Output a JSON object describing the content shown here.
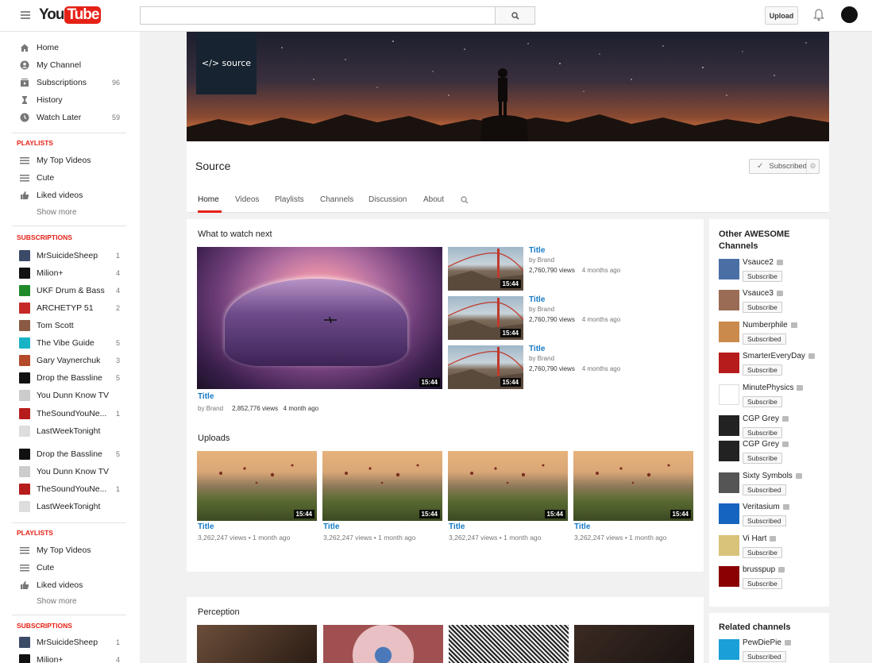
{
  "topbar": {
    "logo_you": "You",
    "logo_tube": "Tube",
    "search_placeholder": "",
    "upload_label": "Upload"
  },
  "sidebar": {
    "main": [
      {
        "label": "Home",
        "icon": "home-icon",
        "count": ""
      },
      {
        "label": "My Channel",
        "icon": "user-icon",
        "count": ""
      },
      {
        "label": "Subscriptions",
        "icon": "subscriptions-icon",
        "count": "96"
      },
      {
        "label": "History",
        "icon": "history-icon",
        "count": ""
      },
      {
        "label": "Watch Later",
        "icon": "clock-icon",
        "count": "59"
      }
    ],
    "playlists_heading": "PLAYLISTS",
    "playlists": [
      {
        "label": "My Top Videos",
        "icon": "list-icon"
      },
      {
        "label": "Cute",
        "icon": "list-icon"
      },
      {
        "label": "Liked videos",
        "icon": "thumbs-up-icon"
      }
    ],
    "show_more": "Show more",
    "subscriptions_heading": "SUBSCRIPTIONS",
    "subscriptions": [
      {
        "label": "MrSuicideSheep",
        "count": "1",
        "color": "#3b4a66"
      },
      {
        "label": "Milion+",
        "count": "4",
        "color": "#111111"
      },
      {
        "label": "UKF Drum & Bass",
        "count": "4",
        "color": "#1f8a2a"
      },
      {
        "label": "ARCHETYP 51",
        "count": "2",
        "color": "#c62828"
      },
      {
        "label": "Tom Scott",
        "count": "",
        "color": "#8a5a44"
      },
      {
        "label": "The Vibe Guide",
        "count": "5",
        "color": "#19b3c6"
      },
      {
        "label": "Gary Vaynerchuk",
        "count": "3",
        "color": "#b34a2a"
      },
      {
        "label": "Drop the Bassline",
        "count": "5",
        "color": "#111111"
      },
      {
        "label": "You Dunn Know TV",
        "count": "",
        "color": "#cccccc"
      },
      {
        "label": "TheSoundYouNe...",
        "count": "1",
        "color": "#b71c1c"
      },
      {
        "label": "LastWeekTonight",
        "count": "",
        "color": "#dddddd"
      },
      {
        "label": "Drop the Bassline",
        "count": "5",
        "color": "#111111"
      },
      {
        "label": "You Dunn Know TV",
        "count": "",
        "color": "#cccccc"
      },
      {
        "label": "TheSoundYouNe...",
        "count": "1",
        "color": "#b71c1c"
      },
      {
        "label": "LastWeekTonight",
        "count": "",
        "color": "#dddddd"
      }
    ],
    "playlists2": [
      {
        "label": "My Top Videos",
        "icon": "list-icon"
      },
      {
        "label": "Cute",
        "icon": "list-icon"
      },
      {
        "label": "Liked videos",
        "icon": "thumbs-up-icon"
      }
    ],
    "subscriptions2": [
      {
        "label": "MrSuicideSheep",
        "count": "1",
        "color": "#3b4a66"
      },
      {
        "label": "Milion+",
        "count": "4",
        "color": "#111111"
      }
    ]
  },
  "channel": {
    "banner_logo": "</> source",
    "name": "Source",
    "subscribe_label": "Subscribed",
    "tabs": [
      "Home",
      "Videos",
      "Playlists",
      "Channels",
      "Discussion",
      "About"
    ]
  },
  "watch_next": {
    "heading": "What to watch next",
    "featured": {
      "title": "Title",
      "by": "by Brand",
      "views": "2,852,776 views",
      "age": "4 month ago",
      "duration": "15:44"
    },
    "side": [
      {
        "title": "Title",
        "by": "by Brand",
        "views": "2,760,790 views",
        "age": "4 months ago",
        "duration": "15:44"
      },
      {
        "title": "Title",
        "by": "by Brand",
        "views": "2,760,790 views",
        "age": "4 months ago",
        "duration": "15:44"
      },
      {
        "title": "Title",
        "by": "by Brand",
        "views": "2,760,790 views",
        "age": "4 months ago",
        "duration": "15:44"
      }
    ]
  },
  "uploads": {
    "heading": "Uploads",
    "items": [
      {
        "title": "Title",
        "meta": "3,262,247 views • 1 month ago",
        "duration": "15:44"
      },
      {
        "title": "Title",
        "meta": "3,262,247 views • 1 month ago",
        "duration": "15:44"
      },
      {
        "title": "Title",
        "meta": "3,262,247 views • 1 month ago",
        "duration": "15:44"
      },
      {
        "title": "Title",
        "meta": "3,262,247 views • 1 month ago",
        "duration": "15:44"
      }
    ]
  },
  "perception": {
    "heading": "Perception"
  },
  "other_channels": {
    "heading": "Other AWESOME Channels",
    "items": [
      {
        "name": "Vsauce2",
        "button": "Subscribe",
        "color": "#4a6fa5"
      },
      {
        "name": "Vsauce3",
        "button": "Subscribe",
        "color": "#9a6b55"
      },
      {
        "name": "Numberphile",
        "button": "Subscribed",
        "color": "#c98a4b"
      },
      {
        "name": "SmarterEveryDay",
        "button": "Subscribe",
        "color": "#b71c1c"
      },
      {
        "name": "MinutePhysics",
        "button": "Subscribe",
        "color": "#ffffff"
      },
      {
        "name": "CGP Grey",
        "button": "Subscribe",
        "color": "#222222"
      },
      {
        "name": "CGP Grey",
        "button": "Subscribe",
        "color": "#222222"
      },
      {
        "name": "Sixty Symbols",
        "button": "Subscribed",
        "color": "#555555"
      },
      {
        "name": "Veritasium",
        "button": "Subscribed",
        "color": "#1565c0"
      },
      {
        "name": "Vi Hart",
        "button": "Subscribe",
        "color": "#d9c27a"
      },
      {
        "name": "brusspup",
        "button": "Subscribe",
        "color": "#8b0000"
      }
    ]
  },
  "related": {
    "heading": "Related channels",
    "items": [
      {
        "name": "PewDiePie",
        "button": "Subscribed",
        "color": "#1a9fd8"
      }
    ]
  }
}
